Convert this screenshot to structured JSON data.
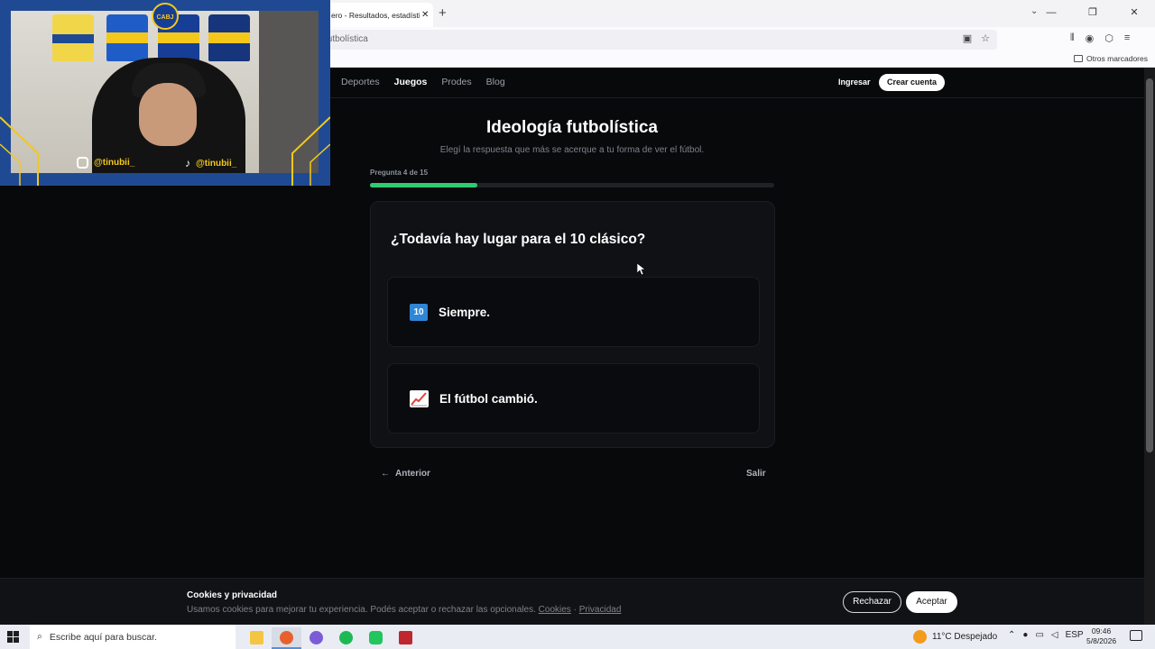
{
  "browser": {
    "tab_title": "ero - Resultados, estadística",
    "tab_close": "✕",
    "new_tab": "+",
    "list_tabs": "⌄",
    "window_buttons": [
      "—",
      "❐",
      "✕"
    ],
    "url": "futbolística",
    "bookmarks_other": "Otros marcadores"
  },
  "header": {
    "nav": [
      "Deportes",
      "Juegos",
      "Prodes",
      "Blog"
    ],
    "active_nav": "Juegos",
    "login": "Ingresar",
    "signup": "Crear cuenta"
  },
  "quiz": {
    "title": "Ideología futbolística",
    "subtitle": "Elegí la respuesta que más se acerque a tu forma de ver el fútbol.",
    "progress_label": "Pregunta 4 de 15",
    "progress_fraction": 0.2667,
    "question": "¿Todavía hay lugar para el 10 clásico?",
    "options": [
      {
        "icon": "keycap-ten-icon",
        "icon_text": "10",
        "label": "Siempre."
      },
      {
        "icon": "chart-increasing-icon",
        "label": "El fútbol cambió."
      }
    ],
    "prev": "Anterior",
    "prev_arrow": "←",
    "exit": "Salir"
  },
  "cookies": {
    "title": "Cookies y privacidad",
    "text": "Usamos cookies para mejorar tu experiencia. Podés aceptar o rechazar las opcionales.",
    "link_cookies": "Cookies",
    "separator": "·",
    "link_privacy": "Privacidad",
    "reject": "Rechazar",
    "accept": "Aceptar"
  },
  "webcam": {
    "instagram": "@tinubii_",
    "tiktok": "@tinubii_",
    "badge": "CABJ"
  },
  "taskbar": {
    "search_placeholder": "Escribe aquí para buscar.",
    "weather": "11°C  Despejado",
    "language": "ESP",
    "time": "09:46",
    "date": "5/8/2026"
  },
  "colors": {
    "accent": "#2ecc71",
    "page_bg": "#08090b",
    "card_bg": "#101115",
    "webcam_frame": "#1f4a93",
    "frame_gold": "#f3c81b"
  }
}
